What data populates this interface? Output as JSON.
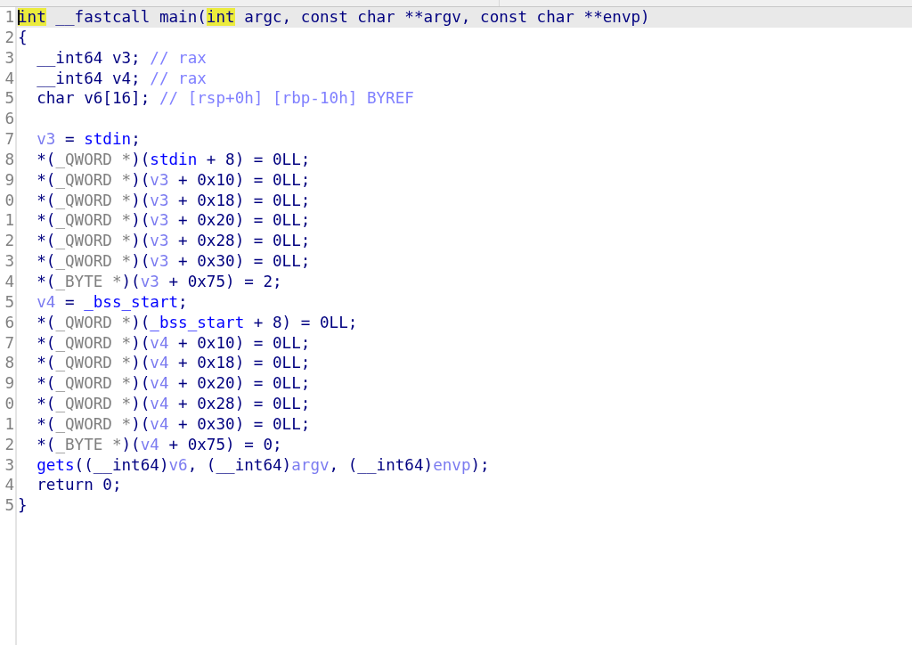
{
  "lines": [
    {
      "number": "1",
      "current": true,
      "tokens": [
        {
          "text": "int",
          "kind": "match"
        },
        {
          "text": " __fastcall main(",
          "kind": "text"
        },
        {
          "text": "int",
          "kind": "match"
        },
        {
          "text": " argc, const char **argv, const char **envp)",
          "kind": "text"
        }
      ]
    },
    {
      "number": "2",
      "current": false,
      "tokens": [
        {
          "text": "{",
          "kind": "text"
        }
      ]
    },
    {
      "number": "3",
      "current": false,
      "tokens": [
        {
          "text": "  __int64 v3; ",
          "kind": "text"
        },
        {
          "text": "// rax",
          "kind": "comment"
        }
      ]
    },
    {
      "number": "4",
      "current": false,
      "tokens": [
        {
          "text": "  __int64 v4; ",
          "kind": "text"
        },
        {
          "text": "// rax",
          "kind": "comment"
        }
      ]
    },
    {
      "number": "5",
      "current": false,
      "tokens": [
        {
          "text": "  char v6[16]; ",
          "kind": "text"
        },
        {
          "text": "// [rsp+0h] [rbp-10h] BYREF",
          "kind": "comment"
        }
      ]
    },
    {
      "number": "6",
      "current": false
    },
    {
      "number": "7",
      "current": false,
      "tokens": [
        {
          "text": "  v3",
          "kind": "local"
        },
        {
          "text": " = ",
          "kind": "text"
        },
        {
          "text": "stdin",
          "kind": "global"
        },
        {
          "text": ";",
          "kind": "text"
        }
      ]
    },
    {
      "number": "8",
      "current": false,
      "tokens": [
        {
          "text": "  *(",
          "kind": "text"
        },
        {
          "text": "_QWORD *",
          "kind": "type"
        },
        {
          "text": ")(",
          "kind": "text"
        },
        {
          "text": "stdin",
          "kind": "global"
        },
        {
          "text": " + 8) = 0LL;",
          "kind": "text"
        }
      ]
    },
    {
      "number": "9",
      "current": false,
      "tokens": [
        {
          "text": "  *(",
          "kind": "text"
        },
        {
          "text": "_QWORD *",
          "kind": "type"
        },
        {
          "text": ")(",
          "kind": "text"
        },
        {
          "text": "v3",
          "kind": "local"
        },
        {
          "text": " + 0x10) = 0LL;",
          "kind": "text"
        }
      ]
    },
    {
      "number": "0",
      "current": false,
      "tokens": [
        {
          "text": "  *(",
          "kind": "text"
        },
        {
          "text": "_QWORD *",
          "kind": "type"
        },
        {
          "text": ")(",
          "kind": "text"
        },
        {
          "text": "v3",
          "kind": "local"
        },
        {
          "text": " + 0x18) = 0LL;",
          "kind": "text"
        }
      ]
    },
    {
      "number": "1",
      "current": false,
      "tokens": [
        {
          "text": "  *(",
          "kind": "text"
        },
        {
          "text": "_QWORD *",
          "kind": "type"
        },
        {
          "text": ")(",
          "kind": "text"
        },
        {
          "text": "v3",
          "kind": "local"
        },
        {
          "text": " + 0x20) = 0LL;",
          "kind": "text"
        }
      ]
    },
    {
      "number": "2",
      "current": false,
      "tokens": [
        {
          "text": "  *(",
          "kind": "text"
        },
        {
          "text": "_QWORD *",
          "kind": "type"
        },
        {
          "text": ")(",
          "kind": "text"
        },
        {
          "text": "v3",
          "kind": "local"
        },
        {
          "text": " + 0x28) = 0LL;",
          "kind": "text"
        }
      ]
    },
    {
      "number": "3",
      "current": false,
      "tokens": [
        {
          "text": "  *(",
          "kind": "text"
        },
        {
          "text": "_QWORD *",
          "kind": "type"
        },
        {
          "text": ")(",
          "kind": "text"
        },
        {
          "text": "v3",
          "kind": "local"
        },
        {
          "text": " + 0x30) = 0LL;",
          "kind": "text"
        }
      ]
    },
    {
      "number": "4",
      "current": false,
      "tokens": [
        {
          "text": "  *(",
          "kind": "text"
        },
        {
          "text": "_BYTE *",
          "kind": "type"
        },
        {
          "text": ")(",
          "kind": "text"
        },
        {
          "text": "v3",
          "kind": "local"
        },
        {
          "text": " + 0x75) = 2;",
          "kind": "text"
        }
      ]
    },
    {
      "number": "5",
      "current": false,
      "tokens": [
        {
          "text": "  v4",
          "kind": "local"
        },
        {
          "text": " = ",
          "kind": "text"
        },
        {
          "text": "_bss_start",
          "kind": "global"
        },
        {
          "text": ";",
          "kind": "text"
        }
      ]
    },
    {
      "number": "6",
      "current": false,
      "tokens": [
        {
          "text": "  *(",
          "kind": "text"
        },
        {
          "text": "_QWORD *",
          "kind": "type"
        },
        {
          "text": ")(",
          "kind": "text"
        },
        {
          "text": "_bss_start",
          "kind": "global"
        },
        {
          "text": " + 8) = 0LL;",
          "kind": "text"
        }
      ]
    },
    {
      "number": "7",
      "current": false,
      "tokens": [
        {
          "text": "  *(",
          "kind": "text"
        },
        {
          "text": "_QWORD *",
          "kind": "type"
        },
        {
          "text": ")(",
          "kind": "text"
        },
        {
          "text": "v4",
          "kind": "local"
        },
        {
          "text": " + 0x10) = 0LL;",
          "kind": "text"
        }
      ]
    },
    {
      "number": "8",
      "current": false,
      "tokens": [
        {
          "text": "  *(",
          "kind": "text"
        },
        {
          "text": "_QWORD *",
          "kind": "type"
        },
        {
          "text": ")(",
          "kind": "text"
        },
        {
          "text": "v4",
          "kind": "local"
        },
        {
          "text": " + 0x18) = 0LL;",
          "kind": "text"
        }
      ]
    },
    {
      "number": "9",
      "current": false,
      "tokens": [
        {
          "text": "  *(",
          "kind": "text"
        },
        {
          "text": "_QWORD *",
          "kind": "type"
        },
        {
          "text": ")(",
          "kind": "text"
        },
        {
          "text": "v4",
          "kind": "local"
        },
        {
          "text": " + 0x20) = 0LL;",
          "kind": "text"
        }
      ]
    },
    {
      "number": "0",
      "current": false,
      "tokens": [
        {
          "text": "  *(",
          "kind": "text"
        },
        {
          "text": "_QWORD *",
          "kind": "type"
        },
        {
          "text": ")(",
          "kind": "text"
        },
        {
          "text": "v4",
          "kind": "local"
        },
        {
          "text": " + 0x28) = 0LL;",
          "kind": "text"
        }
      ]
    },
    {
      "number": "1",
      "current": false,
      "tokens": [
        {
          "text": "  *(",
          "kind": "text"
        },
        {
          "text": "_QWORD *",
          "kind": "type"
        },
        {
          "text": ")(",
          "kind": "text"
        },
        {
          "text": "v4",
          "kind": "local"
        },
        {
          "text": " + 0x30) = 0LL;",
          "kind": "text"
        }
      ]
    },
    {
      "number": "2",
      "current": false,
      "tokens": [
        {
          "text": "  *(",
          "kind": "text"
        },
        {
          "text": "_BYTE *",
          "kind": "type"
        },
        {
          "text": ")(",
          "kind": "text"
        },
        {
          "text": "v4",
          "kind": "local"
        },
        {
          "text": " + 0x75) = 0;",
          "kind": "text"
        }
      ]
    },
    {
      "number": "3",
      "current": false,
      "tokens": [
        {
          "text": "  gets",
          "kind": "global"
        },
        {
          "text": "((__int64)",
          "kind": "text"
        },
        {
          "text": "v6",
          "kind": "local"
        },
        {
          "text": ", (__int64)",
          "kind": "text"
        },
        {
          "text": "argv",
          "kind": "local"
        },
        {
          "text": ", (__int64)",
          "kind": "text"
        },
        {
          "text": "envp",
          "kind": "local"
        },
        {
          "text": ");",
          "kind": "text"
        }
      ]
    },
    {
      "number": "4",
      "current": false,
      "tokens": [
        {
          "text": "  return 0;",
          "kind": "text"
        }
      ]
    },
    {
      "number": "5",
      "current": false,
      "tokens": [
        {
          "text": "}",
          "kind": "text"
        }
      ]
    }
  ]
}
